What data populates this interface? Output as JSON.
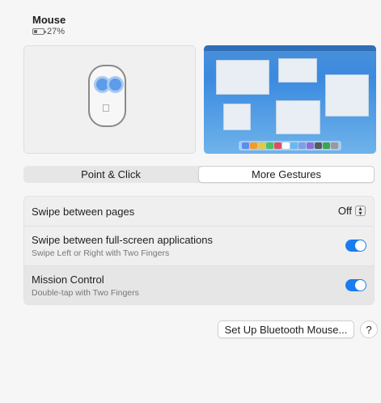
{
  "device": {
    "title": "Mouse",
    "battery_text": "27%",
    "battery_level": 0.27
  },
  "icons": {
    "battery": "battery-icon",
    "mouse": "magic-mouse-icon",
    "apple": "apple-logo-icon",
    "chevron": "up-down-chevron-icon",
    "help": "question-mark-icon"
  },
  "tabs": [
    {
      "label": "Point & Click",
      "selected": false
    },
    {
      "label": "More Gestures",
      "selected": true
    }
  ],
  "settings": {
    "swipe_pages": {
      "label": "Swipe between pages",
      "value": "Off"
    },
    "swipe_fullscreen": {
      "label": "Swipe between full-screen applications",
      "subtitle": "Swipe Left or Right with Two Fingers",
      "enabled": true
    },
    "mission_control": {
      "label": "Mission Control",
      "subtitle": "Double-tap with Two Fingers",
      "enabled": true
    }
  },
  "buttons": {
    "setup_bluetooth": "Set Up Bluetooth Mouse...",
    "help": "?"
  },
  "colors": {
    "accent": "#1b7cf0",
    "gesture_dot": "#5d9ce8"
  },
  "dock_colors": [
    "#5b8def",
    "#f29b2c",
    "#e3c94a",
    "#4fbf63",
    "#e04f5f",
    "#ffffff",
    "#6ab7f2",
    "#7aa0e6",
    "#8c6fd6",
    "#5a5a5a",
    "#3fa34d",
    "#9a9a9a"
  ]
}
